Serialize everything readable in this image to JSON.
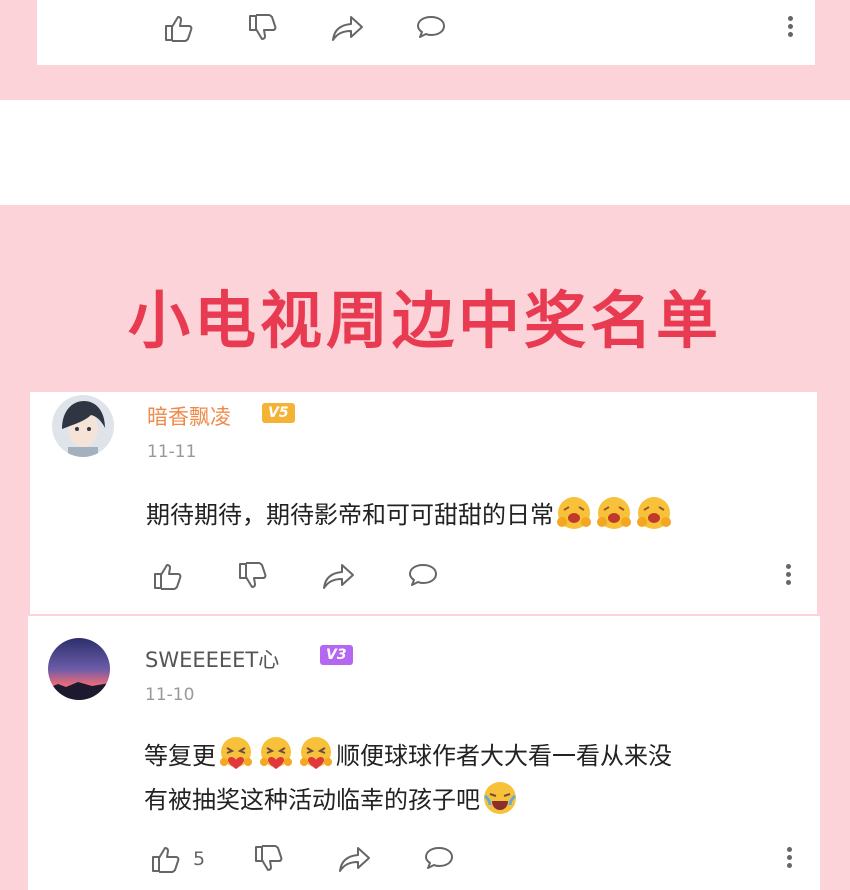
{
  "banner_title": "小电视周边中奖名单",
  "comments": [
    {
      "username": "暗香飘凌",
      "level": "V5",
      "date": "11-11",
      "text": "期待期待，期待影帝和可可甜甜的日常",
      "emojis": [
        "hug-laugh-emoji",
        "hug-laugh-emoji",
        "hug-laugh-emoji"
      ],
      "level_color": "#f5b335"
    },
    {
      "username": "SWEEEEET心",
      "level": "V3",
      "date": "11-10",
      "text_line1": "等复更",
      "text_line1_rest": "顺便球球作者大大看一看从来没",
      "text_line2": "有被抽奖这种活动临幸的孩子吧",
      "emojis_line1": [
        "hug-heart-emoji",
        "hug-heart-emoji",
        "hug-heart-emoji"
      ],
      "emoji_line2": "crying-laugh-emoji",
      "like_count": "5",
      "level_color": "#b467f0"
    }
  ],
  "colors": {
    "pink": "#fbd3d9",
    "title_red": "#e83b52"
  }
}
